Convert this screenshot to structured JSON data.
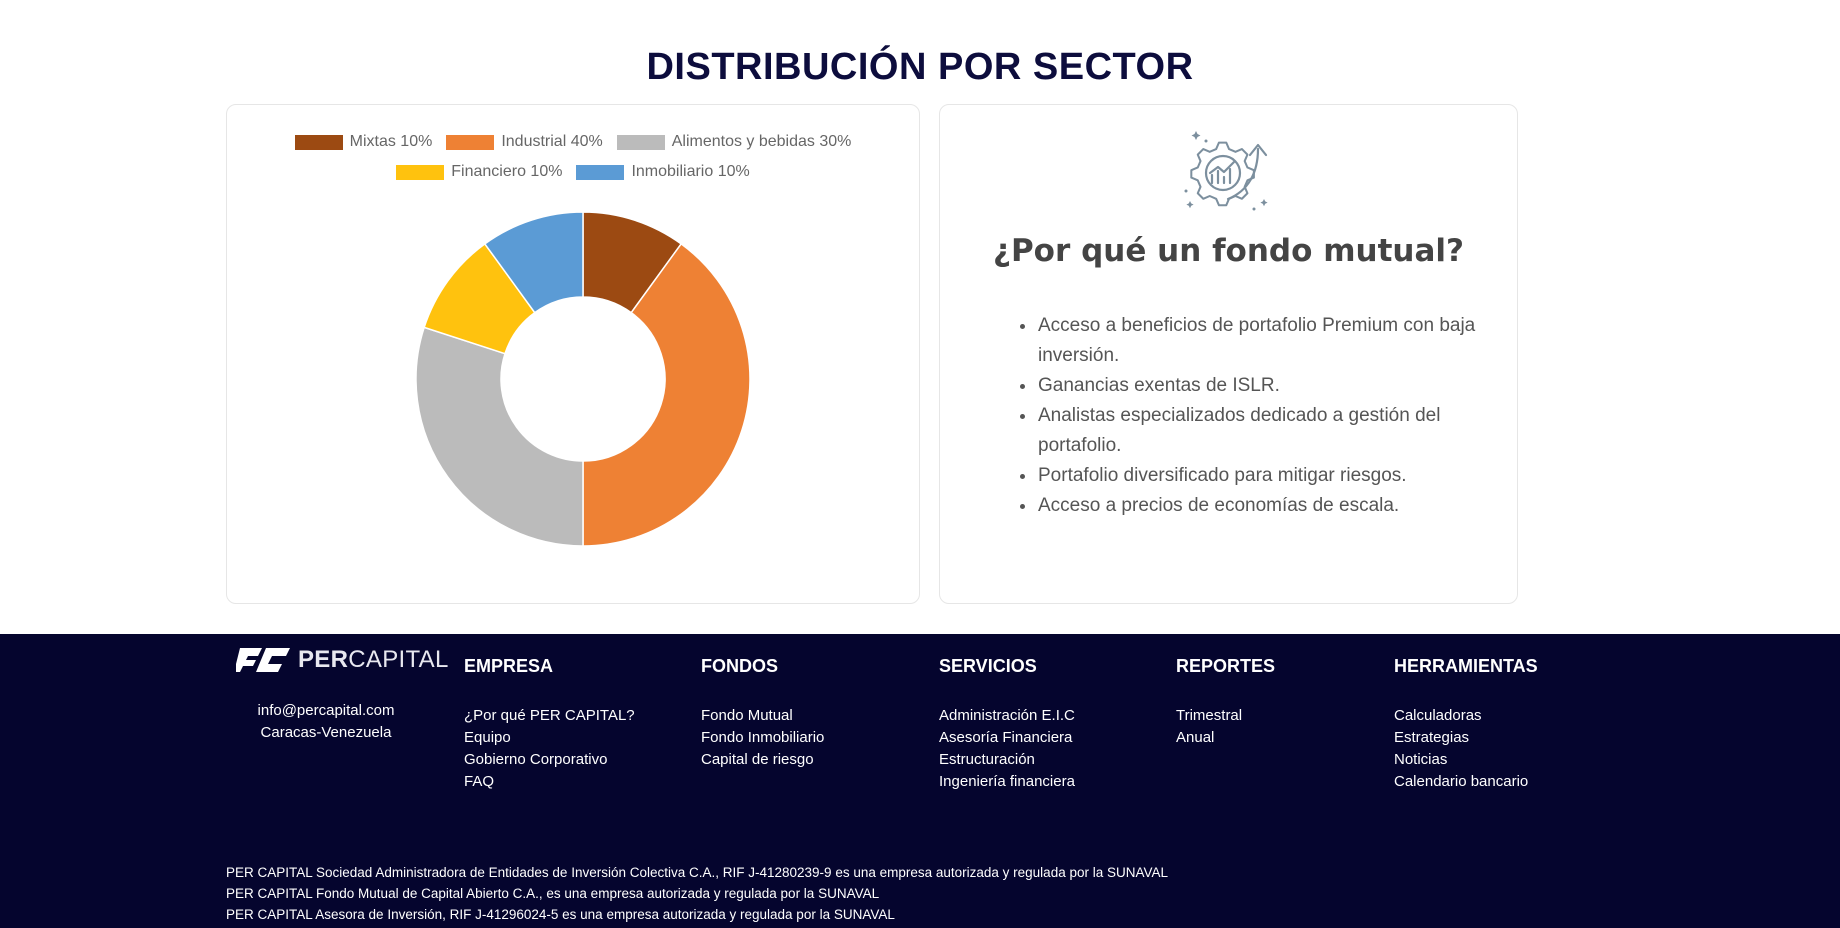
{
  "section": {
    "title": "DISTRIBUCIÓN POR SECTOR"
  },
  "chart_data": {
    "type": "pie",
    "donut": true,
    "title": "",
    "legend_position": "top",
    "slices": [
      {
        "name": "Mixtas 10%",
        "value": 10,
        "color": "#9c4a12"
      },
      {
        "name": "Industrial 40%",
        "value": 40,
        "color": "#ee8134"
      },
      {
        "name": "Alimentos y bebidas 30%",
        "value": 30,
        "color": "#bbbbbb"
      },
      {
        "name": "Financiero 10%",
        "value": 10,
        "color": "#ffc20e"
      },
      {
        "name": "Inmobiliario 10%",
        "value": 10,
        "color": "#5b9bd5"
      }
    ]
  },
  "why": {
    "icon": "growth-gear-chart-icon",
    "title": "¿Por qué un fondo mutual?",
    "items": [
      "Acceso a beneficios de portafolio Premium con baja inversión.",
      "Ganancias exentas de ISLR.",
      "Analistas especializados dedicado a gestión del portafolio.",
      "Portafolio diversificado para mitigar riesgos.",
      "Acceso a precios de economías de escala."
    ]
  },
  "footer": {
    "logo": {
      "bold": "PER",
      "light": "CAPITAL"
    },
    "email": "info@percapital.com",
    "location": "Caracas-Venezuela",
    "columns": [
      {
        "title": "EMPRESA",
        "links": [
          "¿Por qué PER CAPITAL?",
          "Equipo",
          "Gobierno Corporativo",
          "FAQ"
        ]
      },
      {
        "title": "FONDOS",
        "links": [
          "Fondo Mutual",
          "Fondo Inmobiliario",
          "Capital de riesgo"
        ]
      },
      {
        "title": "SERVICIOS",
        "links": [
          "Administración E.I.C",
          "Asesoría Financiera",
          "Estructuración",
          "Ingeniería financiera"
        ]
      },
      {
        "title": "REPORTES",
        "links": [
          "Trimestral",
          "Anual"
        ]
      },
      {
        "title": "HERRAMIENTAS",
        "links": [
          "Calculadoras",
          "Estrategias",
          "Noticias",
          "Calendario bancario"
        ]
      }
    ],
    "legal": [
      "PER CAPITAL Sociedad Administradora de Entidades de Inversión Colectiva C.A., RIF J-41280239-9 es una empresa autorizada y regulada por la SUNAVAL",
      "PER CAPITAL Fondo Mutual de Capital Abierto C.A., es una empresa autorizada y regulada por la SUNAVAL",
      "PER CAPITAL Asesora de Inversión, RIF J-41296024-5 es una empresa autorizada y regulada por la SUNAVAL"
    ]
  },
  "colors": {
    "navy": "#05052e",
    "title": "#0d0d3d"
  }
}
